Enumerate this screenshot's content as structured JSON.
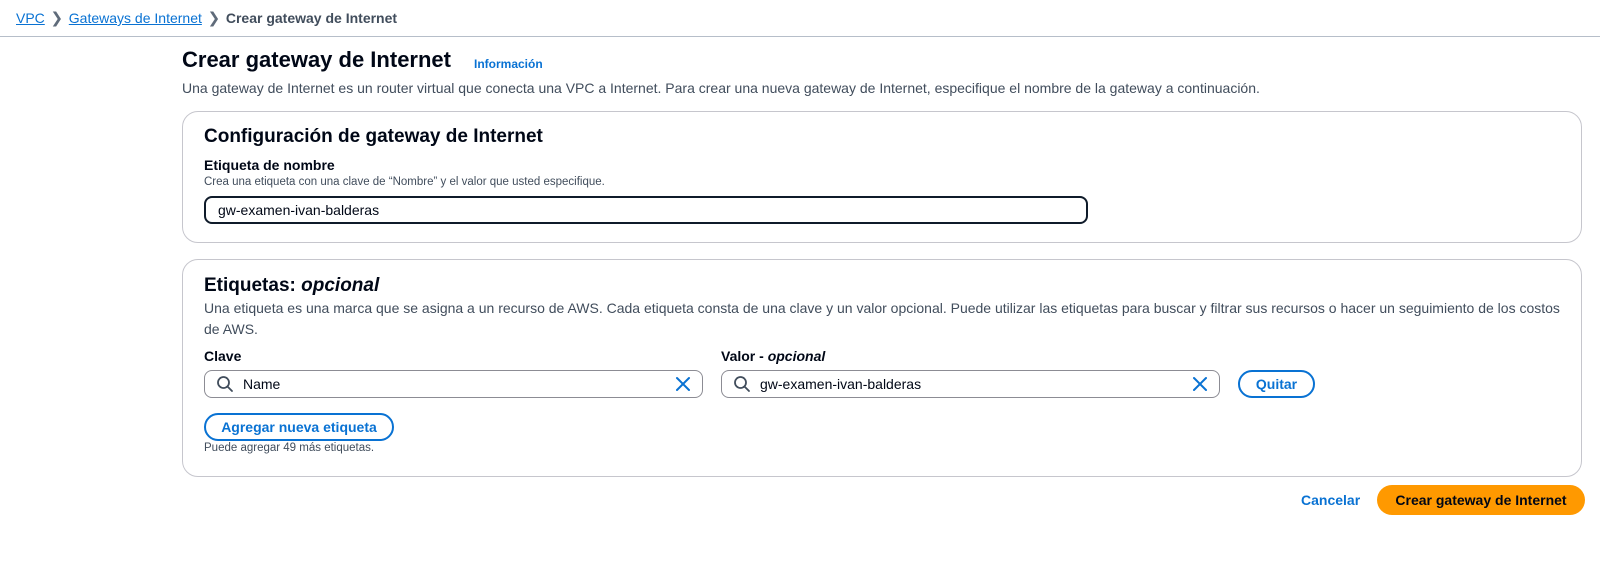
{
  "breadcrumb": {
    "items": [
      "VPC",
      "Gateways de Internet"
    ],
    "current": "Crear gateway de Internet"
  },
  "header": {
    "title": "Crear gateway de Internet",
    "info_link": "Información",
    "description": "Una gateway de Internet es un router virtual que conecta una VPC a Internet. Para crear una nueva gateway de Internet, especifique el nombre de la gateway a continuación."
  },
  "config": {
    "title": "Configuración de gateway de Internet",
    "name_label": "Etiqueta de nombre",
    "name_hint": "Crea una etiqueta con una clave de “Nombre” y el valor que usted especifique.",
    "name_value": "gw-examen-ivan-balderas"
  },
  "tags": {
    "title_main": "Etiquetas:",
    "title_optional": "opcional",
    "description": "Una etiqueta es una marca que se asigna a un recurso de AWS. Cada etiqueta consta de una clave y un valor opcional. Puede utilizar las etiquetas para buscar y filtrar sus recursos o hacer un seguimiento de los costos de AWS.",
    "key_label": "Clave",
    "value_label_main": "Valor -",
    "value_label_optional": "opcional",
    "rows": [
      {
        "key": "Name",
        "value": "gw-examen-ivan-balderas",
        "remove_label": "Quitar"
      }
    ],
    "add_button": "Agregar nueva etiqueta",
    "remaining_hint": "Puede agregar 49 más etiquetas."
  },
  "footer": {
    "cancel": "Cancelar",
    "submit": "Crear gateway de Internet"
  },
  "icons": {
    "breadcrumb_separator": "chevron-right-icon",
    "search": "search-icon",
    "clear": "close-icon"
  },
  "colors": {
    "link": "#0972d3",
    "primary_button": "#ff9900",
    "border": "#c6c6cd",
    "text": "#000716"
  }
}
